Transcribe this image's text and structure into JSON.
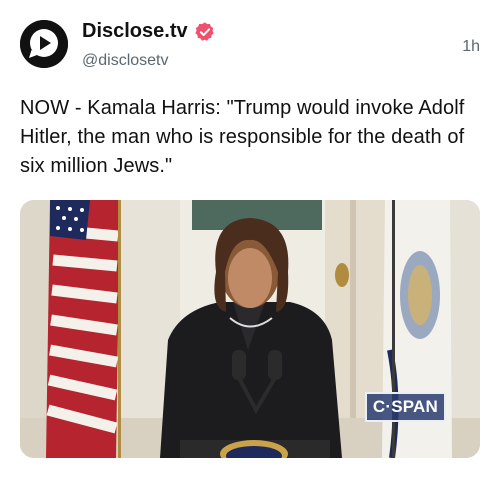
{
  "account": {
    "name": "Disclose.tv",
    "handle": "@disclosetv",
    "verified": true,
    "avatar_icon": "disclose-play-logo-icon",
    "time": "1h"
  },
  "post": {
    "text": "NOW - Kamala Harris: \"Trump would invoke Adolf Hitler, the man who is responsible for the death of six million Jews.\""
  },
  "media": {
    "watermark": "C·SPAN"
  },
  "colors": {
    "badge": "#f0506e",
    "text": "#111111",
    "muted": "#5b6770"
  }
}
